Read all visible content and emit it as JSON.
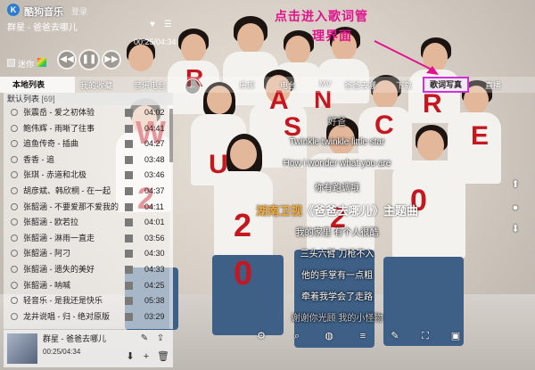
{
  "app": {
    "title": "酷狗音乐",
    "login": "登录",
    "logo_icon": "kugou-logo-icon"
  },
  "player": {
    "song": "群星 - 爸爸去哪儿",
    "time": "00:25/04:34",
    "desktop_lyric_label": "迷你",
    "favorite_icon": "heart-icon"
  },
  "nav": {
    "local_list": "本地列表",
    "cloud": "我的收藏",
    "radio": "音乐电台",
    "music_lib": "乐库",
    "radio2": "电台",
    "mv": "MV",
    "song_info": "爸爸去哪",
    "download": "下载",
    "lyric_photo": "歌词写真",
    "live": "直播"
  },
  "playlist": {
    "header": "默认列表",
    "count": "[69]",
    "rows": [
      {
        "name": "张震岳 - 爱之初体验",
        "dur": "04:02"
      },
      {
        "name": "鲍伟辉 - 雨晰了往事",
        "dur": "04:41"
      },
      {
        "name": "追鱼传奇 - 插曲",
        "dur": "04:27"
      },
      {
        "name": "香香 - 追",
        "dur": "03:48"
      },
      {
        "name": "张琪 - 赤道和北极",
        "dur": "03:46"
      },
      {
        "name": "胡彦斌、韩欣桐 - 在一起",
        "dur": "04:37"
      },
      {
        "name": "张韶涵 - 不要爱那不爱我的人",
        "dur": "04:11"
      },
      {
        "name": "张韶涵 - 欧若拉",
        "dur": "04:01"
      },
      {
        "name": "张韶涵 - 淋雨一直走",
        "dur": "03:56"
      },
      {
        "name": "张韶涵 - 阿刁",
        "dur": "04:30"
      },
      {
        "name": "张韶涵 - 遗失的美好",
        "dur": "04:33"
      },
      {
        "name": "张韶涵 - 呐喊",
        "dur": "04:25"
      },
      {
        "name": "轻音乐 - 是我还是快乐",
        "dur": "05:38"
      },
      {
        "name": "龙井说唱 - 归 - 绝对原版",
        "dur": "03:29"
      }
    ]
  },
  "mini": {
    "title": "群星 - 爸爸去哪儿",
    "time": "00:25/04:34"
  },
  "lyrics": {
    "l0": "好爸",
    "l1": "Twinkle twinkle little star",
    "l2": "How i wonder what you are",
    "l3": "你有跑调哦",
    "current_hl": "湖南卫视",
    "current_rest": "《爸爸去哪儿》主题曲",
    "l5": "我的家里 有个人很酷",
    "l6": "三头六臂 刀枪不入",
    "l7": "他的手掌有一点粗",
    "l8": "牵着我学会了走路",
    "l9": "谢谢你光顾 我的小怪物"
  },
  "annotation": {
    "line1": "点击进入歌词管",
    "line2": "理界面",
    "color": "#e0148c"
  },
  "colors": {
    "highlight_lyric": "#f4ad3c",
    "tab_border": "#d12fd8"
  }
}
